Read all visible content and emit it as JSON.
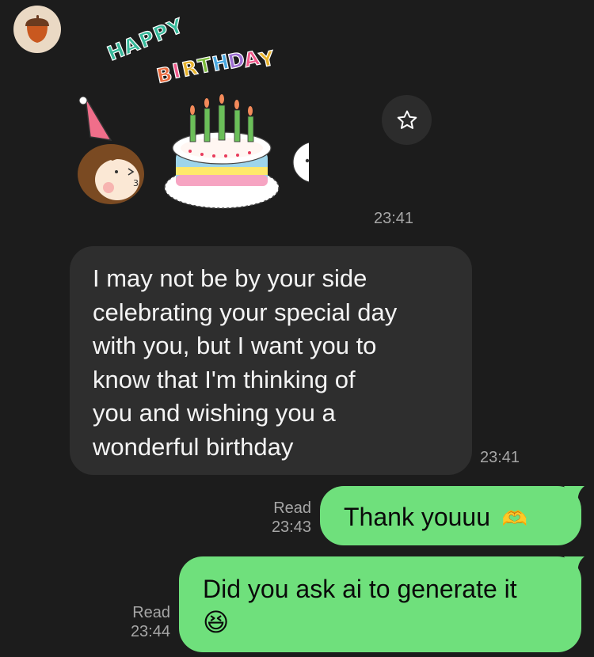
{
  "contact": {
    "avatar_icon": "acorn-icon"
  },
  "messages": [
    {
      "type": "sticker",
      "direction": "incoming",
      "text_art": "HAPPY BIRTHDAY",
      "time": "23:41"
    },
    {
      "type": "text",
      "direction": "incoming",
      "lines": [
        "I may not be by your side",
        "celebrating your special day",
        "with you, but I want you to",
        "know that I'm thinking of",
        "you and wishing you a",
        "wonderful birthday"
      ],
      "time": "23:41"
    },
    {
      "type": "text",
      "direction": "outgoing",
      "text": "Thank youuu",
      "emoji": "🫶",
      "status": "Read",
      "time": "23:43"
    },
    {
      "type": "text",
      "direction": "outgoing",
      "text": "Did you ask ai to generate it",
      "emoji": "😆",
      "status": "Read",
      "time": "23:44"
    }
  ],
  "colors": {
    "background": "#1c1c1c",
    "incoming_bubble": "#2e2e2e",
    "outgoing_bubble": "#6fe07c",
    "meta_text": "#a6a6a6"
  }
}
